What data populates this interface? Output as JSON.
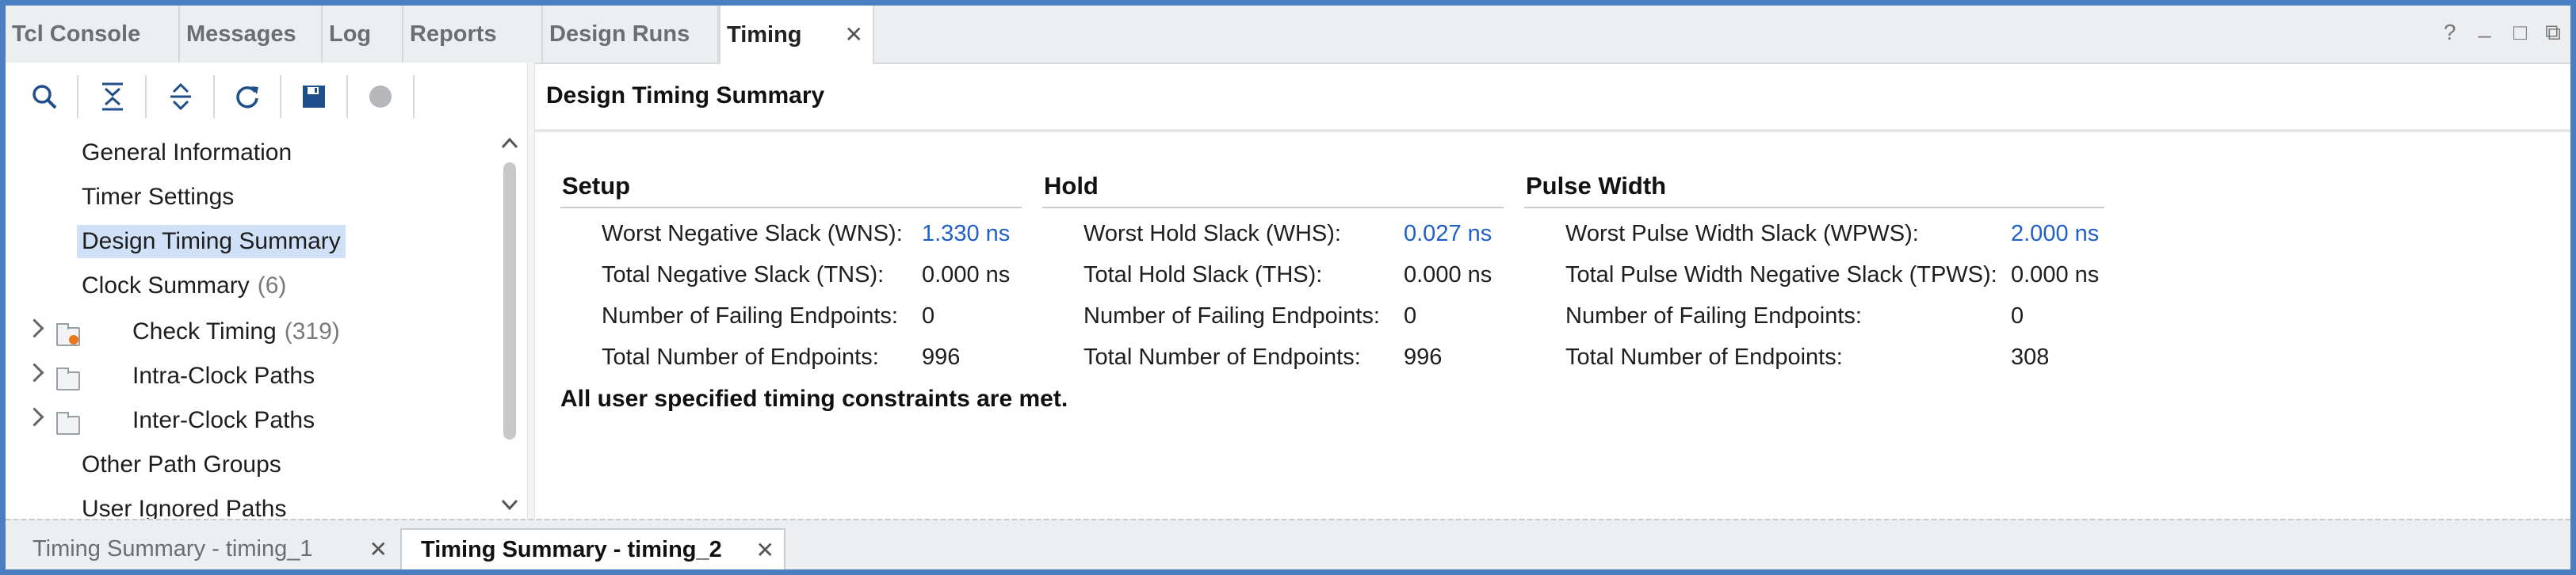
{
  "top_tabs": [
    {
      "label": "Tcl Console"
    },
    {
      "label": "Messages"
    },
    {
      "label": "Log"
    },
    {
      "label": "Reports"
    },
    {
      "label": "Design Runs"
    },
    {
      "label": "Timing",
      "active": true
    }
  ],
  "window_controls": {
    "help": "?",
    "minimize": "_",
    "restore": "□",
    "popout": "⧉"
  },
  "tab_close_glyph": "✕",
  "toolbar": {
    "icons": [
      "search-icon",
      "collapse-all-icon",
      "expand-all-icon",
      "refresh-icon",
      "save-icon",
      "stop-icon"
    ]
  },
  "tree": {
    "items": [
      {
        "label": "General Information"
      },
      {
        "label": "Timer Settings"
      },
      {
        "label": "Design Timing Summary",
        "selected": true
      },
      {
        "label": "Clock Summary",
        "count": "(6)"
      },
      {
        "label": "Check Timing",
        "count": "(319)",
        "expandable": true
      },
      {
        "label": "Intra-Clock Paths",
        "expandable": true
      },
      {
        "label": "Inter-Clock Paths",
        "expandable": true
      },
      {
        "label": "Other Path Groups"
      },
      {
        "label": "User Ignored Paths"
      }
    ]
  },
  "panel": {
    "title": "Design Timing Summary",
    "setup": {
      "title": "Setup",
      "rows": [
        {
          "label": "Worst Negative Slack (WNS):",
          "value": "1.330 ns"
        },
        {
          "label": "Total Negative Slack (TNS):",
          "value": "0.000 ns"
        },
        {
          "label": "Number of Failing Endpoints:",
          "value": "0"
        },
        {
          "label": "Total Number of Endpoints:",
          "value": "996"
        }
      ]
    },
    "hold": {
      "title": "Hold",
      "rows": [
        {
          "label": "Worst Hold Slack (WHS):",
          "value": "0.027 ns"
        },
        {
          "label": "Total Hold Slack (THS):",
          "value": "0.000 ns"
        },
        {
          "label": "Number of Failing Endpoints:",
          "value": "0"
        },
        {
          "label": "Total Number of Endpoints:",
          "value": "996"
        }
      ]
    },
    "pulse": {
      "title": "Pulse Width",
      "rows": [
        {
          "label": "Worst Pulse Width Slack (WPWS):",
          "value": "2.000 ns"
        },
        {
          "label": "Total Pulse Width Negative Slack (TPWS):",
          "value": "0.000 ns"
        },
        {
          "label": "Number of Failing Endpoints:",
          "value": "0"
        },
        {
          "label": "Total Number of Endpoints:",
          "value": "308"
        }
      ]
    },
    "status_message": "All user specified timing constraints are met."
  },
  "bottom_tabs": [
    {
      "label": "Timing Summary - timing_1"
    },
    {
      "label": "Timing Summary - timing_2",
      "active": true
    }
  ],
  "colors": {
    "frame": "#4a7fc1",
    "link": "#1f5fc8",
    "selection": "#cfe0f7"
  }
}
